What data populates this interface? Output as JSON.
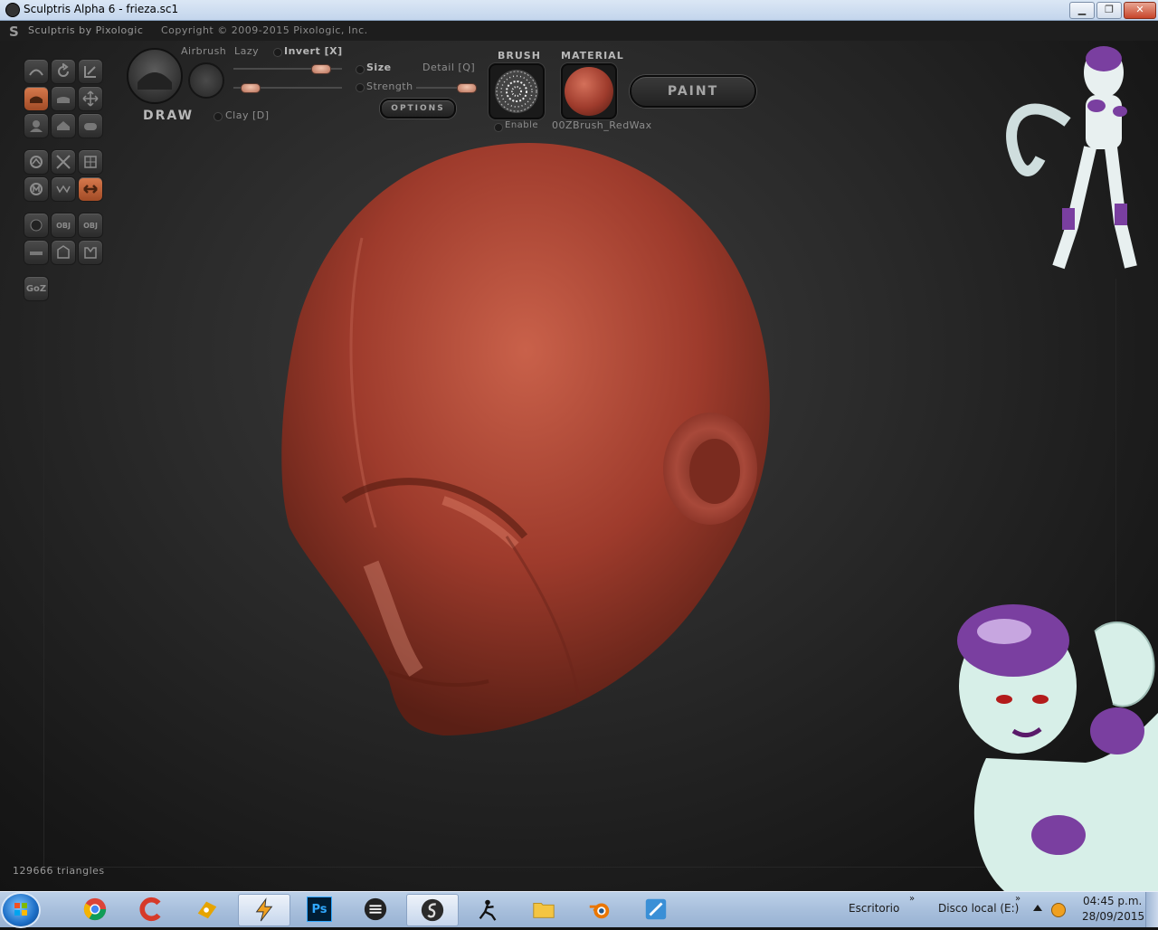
{
  "window": {
    "title": "Sculptris Alpha 6 - frieza.sc1",
    "minimize": "▁",
    "maximize": "❐",
    "close": "✕"
  },
  "header": {
    "brand": "Sculptris by Pixologic",
    "copyright": "Copyright © 2009-2015 Pixologic, Inc."
  },
  "toolbar": {
    "airbrush": "Airbrush",
    "lazy": "Lazy",
    "invert": "Invert [X]",
    "size": "Size",
    "detail": "Detail [Q]",
    "strength": "Strength",
    "draw": "DRAW",
    "clay": "Clay [D]",
    "options": "OPTIONS",
    "brush": "BRUSH",
    "enable": "Enable",
    "material": "MATERIAL",
    "material_name": "00ZBrush_RedWax",
    "paint": "PAINT",
    "goz": "GoZ",
    "obj1": "OBJ",
    "obj2": "OBJ"
  },
  "status": {
    "triangles": "129666 triangles"
  },
  "taskbar": {
    "desktop_label": "Escritorio",
    "disk_label": "Disco local (E:)",
    "chevron": "»",
    "time": "04:45 p.m.",
    "date": "28/09/2015",
    "ps_label": "Ps",
    "apps": [
      "chrome",
      "ccleaner",
      "unknown-tool",
      "winamp",
      "photoshop",
      "stream",
      "sculptris",
      "zbrush",
      "folder",
      "blender",
      "paint-app"
    ]
  },
  "colors": {
    "clay": "#9e3b2c",
    "accent_orange": "#c2643a",
    "bg": "#2a2a2a"
  }
}
